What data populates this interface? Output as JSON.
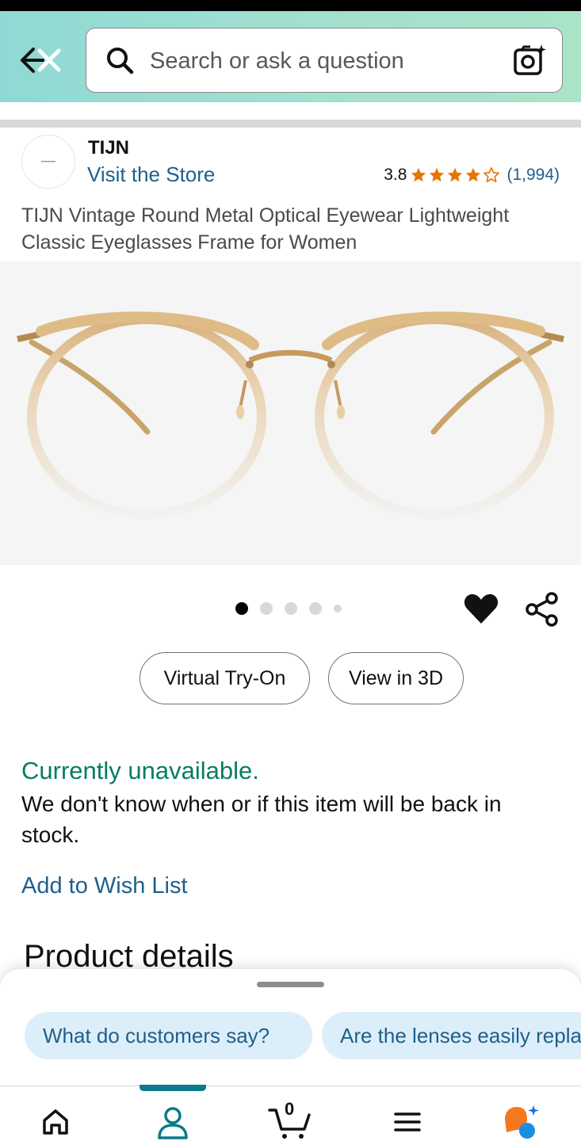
{
  "header": {
    "search_placeholder": "Search or ask a question",
    "back_icon": "back-close-icon",
    "search_icon": "search-icon",
    "camera_icon": "camera-scan-icon"
  },
  "product": {
    "brand": "TIJN",
    "store_link": "Visit the Store",
    "rating_value": "3.8",
    "rating": 3.8,
    "rating_count": "(1,994)",
    "title": "TIJN Vintage Round Metal Optical Eyewear Lightweight Classic Eyeglasses Frame for Women",
    "star_color": "#e77600"
  },
  "gallery": {
    "image_count": 5,
    "active_index": 0
  },
  "actions": {
    "virtual_try_on": "Virtual Try-On",
    "view_3d": "View in 3D"
  },
  "availability": {
    "status": "Currently unavailable.",
    "description": "We don't know when or if this item will be back in stock.",
    "status_color": "#067d62"
  },
  "wishlist_link": "Add to Wish List",
  "details_heading": "Product details",
  "suggestions": {
    "chips": [
      "What do customers say?",
      "Are the lenses easily replaceable?"
    ]
  },
  "bottom_nav": {
    "cart_count": "0",
    "active_item": "you",
    "accent_color": "#0a7b8c"
  }
}
